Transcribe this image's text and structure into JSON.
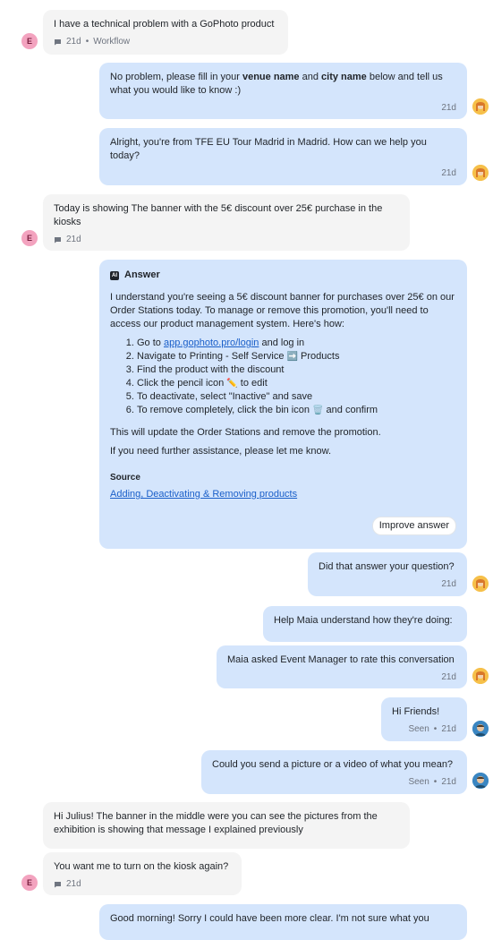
{
  "messages": {
    "m1": {
      "text": "I have a technical problem with a GoPhoto product",
      "time": "21d",
      "channel": "Workflow",
      "sep": "•"
    },
    "m2": {
      "pre": "No problem, please fill in your ",
      "b1": "venue name",
      "mid": " and ",
      "b2": "city name",
      "post": " below and tell us what you would like to know :)",
      "time": "21d"
    },
    "m3": {
      "text": "Alright, you're from TFE EU Tour Madrid in Madrid. How can we help you today?",
      "time": "21d"
    },
    "m4": {
      "text": "Today is showing The banner with the 5€ discount over 25€ purchase in the kiosks",
      "time": "21d"
    },
    "m6": {
      "text": "Did that answer your question?",
      "time": "21d"
    },
    "m7": {
      "text": "Help Maia understand how they're doing:"
    },
    "m8": {
      "text": "Maia asked Event Manager to rate this conversation",
      "time": "21d"
    },
    "m9": {
      "text": "Hi Friends!",
      "status": "Seen",
      "sep": "•",
      "time": "21d"
    },
    "m10": {
      "text": "Could you send a picture or a video of what you mean?",
      "status": "Seen",
      "sep": "•",
      "time": "21d"
    },
    "m11": {
      "text": "Hi Julius! The banner in the middle were you can see the pictures from the exhibition is showing that message I explained previously"
    },
    "m12": {
      "text": "You want me to turn on the kiosk again?",
      "time": "21d"
    },
    "m13": {
      "text": "Good morning! Sorry I could have been more clear. I'm not sure what you"
    }
  },
  "answer": {
    "badge": "AI",
    "title": "Answer",
    "intro": "I understand you're seeing a 5€ discount banner for purchases over 25€ on our Order Stations today. To manage or remove this promotion, you'll need to access our product management system. Here's how:",
    "step1_pre": "Go to ",
    "step1_link": "app.gophoto.pro/login",
    "step1_post": " and log in",
    "step2_pre": "Navigate to Printing - Self Service ",
    "step2_emoji": "➡️",
    "step2_post": " Products",
    "step3": "Find the product with the discount",
    "step4_pre": "Click the pencil icon ",
    "step4_emoji": "✏️",
    "step4_post": " to edit",
    "step5": "To deactivate, select \"Inactive\" and save",
    "step6_pre": "To remove completely, click the bin icon ",
    "step6_emoji": "🗑️",
    "step6_post": " and confirm",
    "outro1": "This will update the Order Stations and remove the promotion.",
    "outro2": "If you need further assistance, please let me know.",
    "source_label": "Source",
    "source_link": "Adding, Deactivating & Removing products",
    "improve": "Improve answer"
  },
  "avatars": {
    "customer_initial": "E"
  },
  "colors": {
    "incoming": "#f4f4f4",
    "outgoing": "#d4e5fc",
    "link": "#1a5fc9",
    "avatar_e": "#f3a3bf"
  },
  "icons": {
    "channel": "chat-bubble-icon",
    "bot_avatar": "maia-avatar",
    "agent_avatar": "julius-avatar"
  }
}
